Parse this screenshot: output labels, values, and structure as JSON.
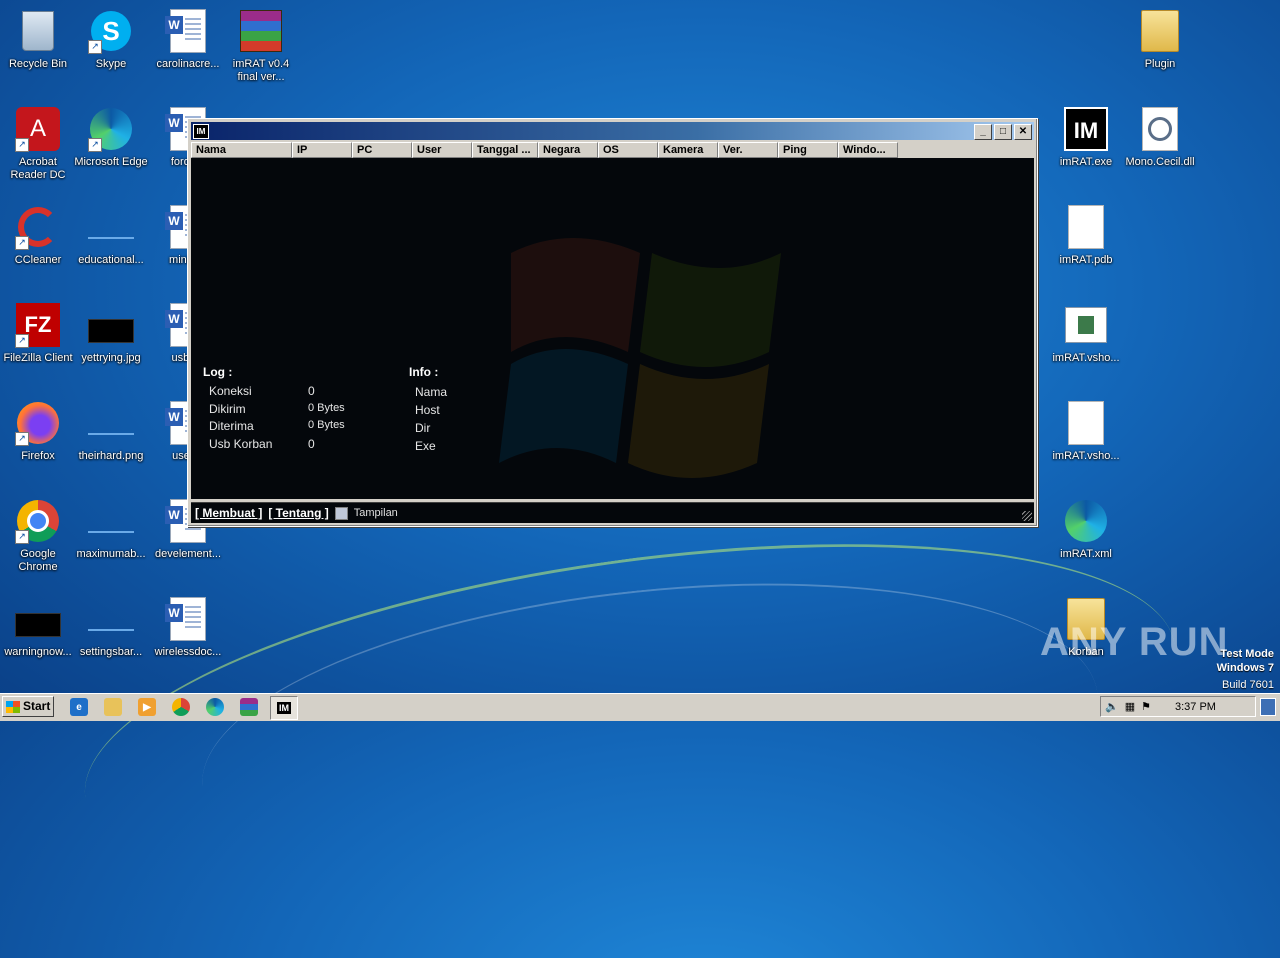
{
  "desktop": {
    "icons": [
      {
        "label": "Recycle Bin"
      },
      {
        "label": "Skype"
      },
      {
        "label": "carolinacre..."
      },
      {
        "label": "imRAT v0.4 final ver..."
      },
      {
        "label": "Plugin"
      },
      {
        "label": "Acrobat Reader DC"
      },
      {
        "label": "Microsoft Edge"
      },
      {
        "label": "fordme"
      },
      {
        "label": "imRAT.exe"
      },
      {
        "label": "Mono.Cecil.dll"
      },
      {
        "label": "CCleaner"
      },
      {
        "label": "educational..."
      },
      {
        "label": "minisho"
      },
      {
        "label": "imRAT.pdb"
      },
      {
        "label": "FileZilla Client"
      },
      {
        "label": "yettrying.jpg"
      },
      {
        "label": "usbres"
      },
      {
        "label": "imRAT.vsho..."
      },
      {
        "label": "Firefox"
      },
      {
        "label": "theirhard.png"
      },
      {
        "label": "usefull"
      },
      {
        "label": "imRAT.vsho..."
      },
      {
        "label": "Google Chrome"
      },
      {
        "label": "maximumab..."
      },
      {
        "label": "develement..."
      },
      {
        "label": "imRAT.xml"
      },
      {
        "label": "warningnow..."
      },
      {
        "label": "settingsbar..."
      },
      {
        "label": "wirelessdoc..."
      },
      {
        "label": "Korban"
      }
    ],
    "watermark": {
      "line1": "Test Mode",
      "line2": "Windows 7",
      "line3": "Build 7601"
    },
    "anyrun": "ANY RUN"
  },
  "window": {
    "title_icon": "IM",
    "columns": [
      "Nama",
      "IP",
      "PC",
      "User",
      "Tanggal ...",
      "Negara",
      "OS",
      "Kamera",
      "Ver.",
      "Ping",
      "Windo..."
    ],
    "log": {
      "title": "Log :",
      "rows": [
        {
          "label": "Koneksi",
          "value": "0"
        },
        {
          "label": "Dikirim",
          "value": "0 Bytes"
        },
        {
          "label": "Diterima",
          "value": "0 Bytes"
        },
        {
          "label": "Usb Korban",
          "value": "0"
        }
      ]
    },
    "info": {
      "title": "Info :",
      "rows": [
        "Nama",
        "Host",
        "Dir",
        "Exe"
      ]
    },
    "bottom": {
      "membuat": "[ Membuat ]",
      "tentang": "[ Tentang ]",
      "tampilan": "Tampilan"
    }
  },
  "taskbar": {
    "start": "Start",
    "clock": "3:37 PM"
  }
}
